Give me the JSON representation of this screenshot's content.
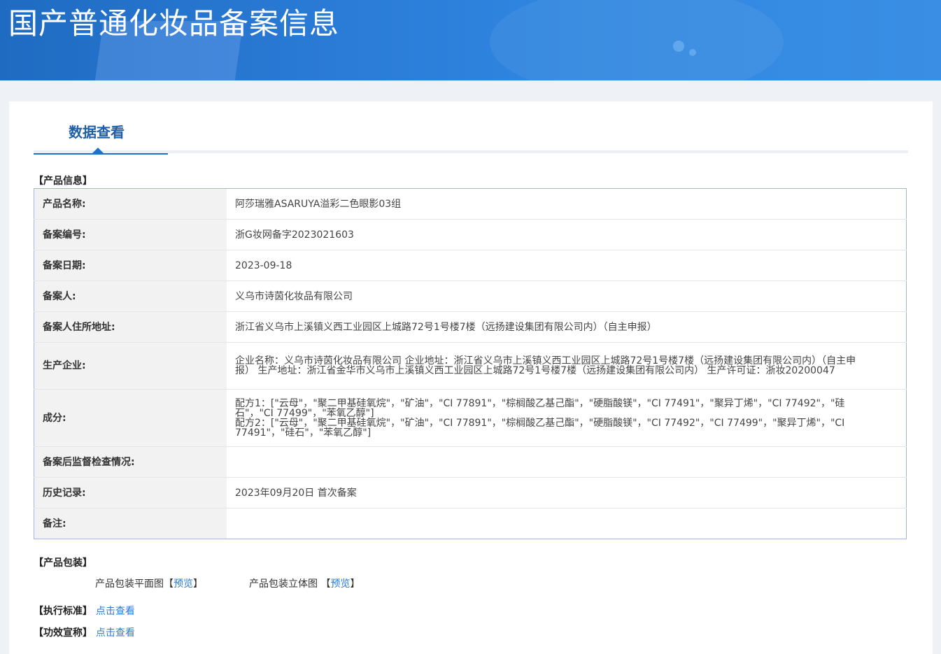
{
  "banner": {
    "title": "国产普通化妆品备案信息"
  },
  "tab": {
    "title": "数据查看"
  },
  "product_section": {
    "label": "【产品信息】"
  },
  "rows": [
    {
      "key": "产品名称:",
      "value": "阿莎瑞雅ASARUYA溢彩二色眼影03组"
    },
    {
      "key": "备案编号:",
      "value": "浙G妆网备字2023021603"
    },
    {
      "key": "备案日期:",
      "value": "2023-09-18"
    },
    {
      "key": "备案人:",
      "value": "义乌市诗茵化妆品有限公司"
    },
    {
      "key": "备案人住所地址:",
      "value": "浙江省义乌市上溪镇义西工业园区上城路72号1号楼7楼（远扬建设集团有限公司内）（自主申报）"
    },
    {
      "key": "生产企业:",
      "value": "企业名称：义乌市诗茵化妆品有限公司 企业地址：浙江省义乌市上溪镇义西工业园区上城路72号1号楼7楼（远扬建设集团有限公司内）（自主申报） 生产地址：浙江省金华市义乌市上溪镇义西工业园区上城路72号1号楼7楼（远扬建设集团有限公司内） 生产许可证：浙妆20200047"
    },
    {
      "key": "成分:",
      "value": "配方1：[\"云母\"，\"聚二甲基硅氧烷\"，\"矿油\"，\"CI 77891\"，\"棕榈酸乙基己酯\"，\"硬脂酸镁\"，\"CI 77491\"，\"聚异丁烯\"，\"CI 77492\"，\"硅石\"，\"CI 77499\"，\"苯氧乙醇\"]",
      "value2": "配方2：[\"云母\"，\"聚二甲基硅氧烷\"，\"矿油\"，\"CI 77891\"，\"棕榈酸乙基己酯\"，\"硬脂酸镁\"，\"CI 77492\"，\"CI 77499\"，\"聚异丁烯\"，\"CI 77491\"，\"硅石\"，\"苯氧乙醇\"]"
    },
    {
      "key": "备案后监督检查情况:",
      "value": ""
    },
    {
      "key": "历史记录:",
      "value": "2023年09月20日 首次备案"
    },
    {
      "key": "备注:",
      "value": ""
    }
  ],
  "packaging": {
    "label": "【产品包装】",
    "flat_label": "产品包装平面图",
    "flat_bracket_open": "【",
    "flat_link": "预览",
    "flat_bracket_close": "】",
    "stereo_label": "产品包装立体图",
    "stereo_bracket_open": "【",
    "stereo_link": "预览",
    "stereo_bracket_close": "】"
  },
  "standard": {
    "label": "【执行标准】",
    "link": "点击查看"
  },
  "efficacy": {
    "label": "【功效宣称】",
    "link": "点击查看"
  },
  "colors": {
    "banner": "#2a7bd6",
    "accent": "#1e72c9",
    "link": "#2b7bd0",
    "table_border": "#9fb8d6"
  }
}
